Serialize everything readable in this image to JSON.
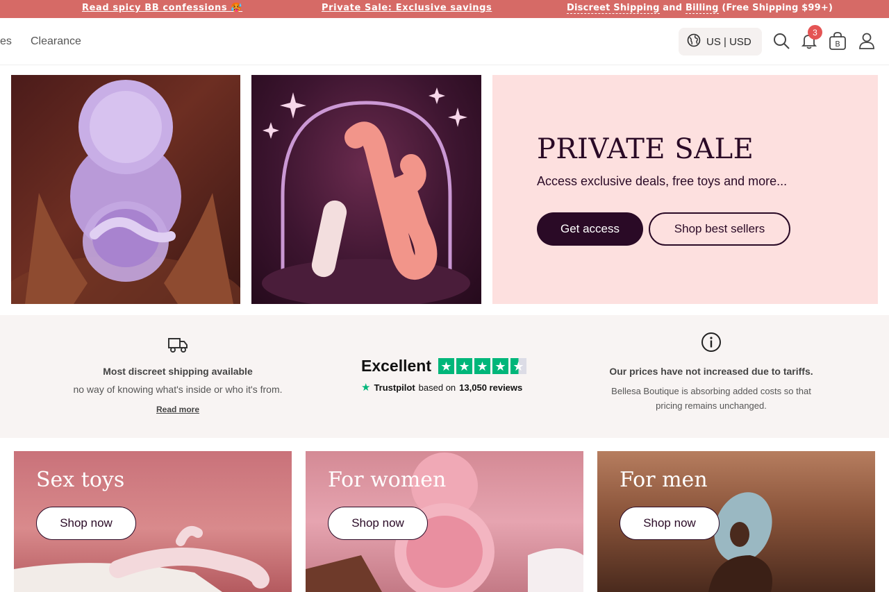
{
  "announcement": {
    "item1": "Read spicy BB confessions 🥵",
    "item2": "Private Sale: Exclusive savings",
    "item3_link1": "Discreet Shipping",
    "item3_and": " and ",
    "item3_link2": "Billing",
    "item3_suffix": " (Free Shipping $99+)"
  },
  "nav": {
    "cut_item": "es",
    "clearance": "Clearance"
  },
  "header": {
    "locale": "US | USD",
    "notification_count": "3",
    "cart_letter": "B",
    "icons": [
      "globe-icon",
      "search-icon",
      "bell-icon",
      "bag-icon",
      "user-icon"
    ]
  },
  "promo": {
    "title": "PRIVATE SALE",
    "subtitle": "Access exclusive deals, free toys and more...",
    "primary_button": "Get access",
    "secondary_button": "Shop best sellers"
  },
  "info": {
    "shipping_title": "Most discreet shipping available",
    "shipping_desc": "no way of knowing what's inside or who it's from.",
    "shipping_link": "Read more",
    "trustpilot_rating": "Excellent",
    "trustpilot_name": "Trustpilot",
    "trustpilot_based": "based on",
    "trustpilot_reviews": "13,050 reviews",
    "tariff_title": "Our prices have not increased due to tariffs.",
    "tariff_desc": "Bellesa Boutique is absorbing added costs so that pricing remains unchanged."
  },
  "categories": [
    {
      "title": "Sex toys",
      "button": "Shop now"
    },
    {
      "title": "For women",
      "button": "Shop now"
    },
    {
      "title": "For men",
      "button": "Shop now"
    }
  ],
  "colors": {
    "announcement_bg": "#d66a66",
    "brand_dark": "#2a0a26",
    "promo_bg": "#fde0df",
    "badge": "#e45454",
    "trustpilot_green": "#00b67a"
  }
}
